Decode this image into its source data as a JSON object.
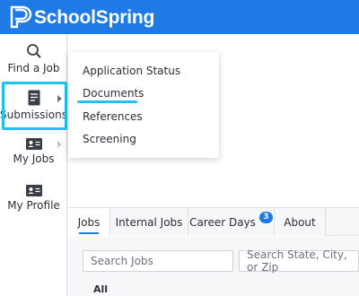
{
  "header": {
    "brand": "SchoolSpring",
    "logo_icon": "schoolspring-logo-icon",
    "brand_color": "#1f7ae6"
  },
  "sidebar": {
    "items": [
      {
        "label": "Find a Job",
        "icon": "search-icon"
      },
      {
        "label": "Submissions",
        "icon": "document-icon"
      },
      {
        "label": "My Jobs",
        "icon": "id-card-icon"
      },
      {
        "label": "My Profile",
        "icon": "id-card-icon"
      }
    ]
  },
  "submissions_menu": {
    "items": [
      {
        "label": "Application Status"
      },
      {
        "label": "Documents"
      },
      {
        "label": "References"
      },
      {
        "label": "Screening"
      }
    ]
  },
  "tabs": [
    {
      "label": "Jobs",
      "active": true
    },
    {
      "label": "Internal Jobs",
      "active": false
    },
    {
      "label": "Career Days",
      "active": false,
      "badge": "3"
    },
    {
      "label": "About",
      "active": false
    }
  ],
  "search": {
    "jobs_placeholder": "Search Jobs",
    "location_placeholder": "Search State, City, or Zip"
  },
  "results": {
    "filter_label": "All"
  },
  "highlight_color": "#1ec3ef"
}
